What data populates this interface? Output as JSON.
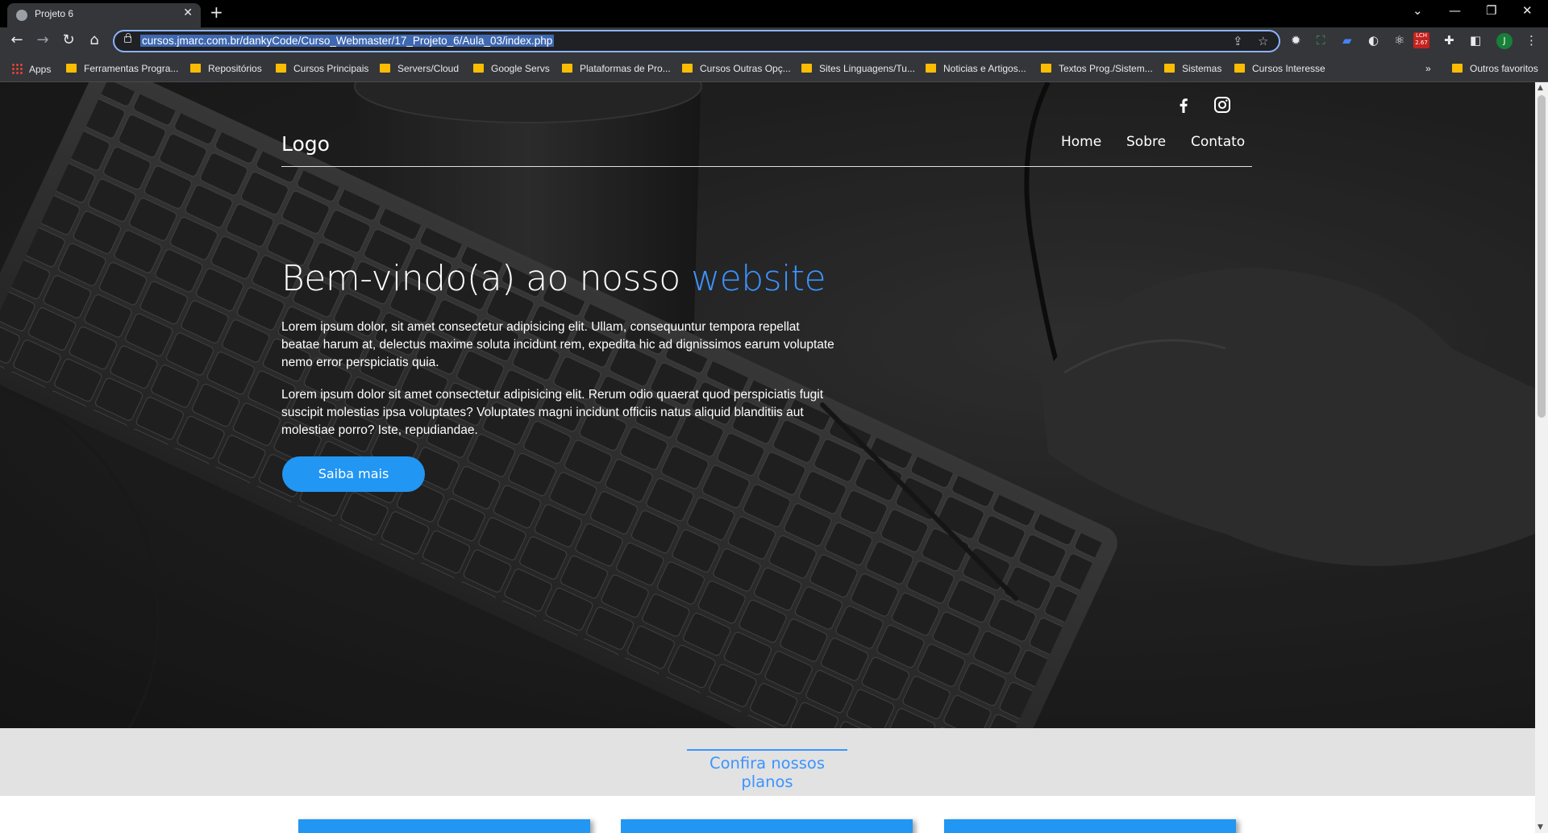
{
  "browser": {
    "tab_title": "Projeto 6",
    "url": "cursos.jmarc.com.br/dankyCode/Curso_Webmaster/17_Projeto_6/Aula_03/index.php",
    "extension_badge": "LCH 2.67",
    "profile_initial": "J",
    "bookmarks": [
      "Apps",
      "Ferramentas Progra...",
      "Repositórios",
      "Cursos Principais",
      "Servers/Cloud",
      "Google Servs",
      "Plataformas de Pro...",
      "Cursos Outras Opç...",
      "Sites Linguagens/Tu...",
      "Noticias e Artigos...",
      "Textos Prog./Sistem...",
      "Sistemas",
      "Cursos Interesse"
    ],
    "bookmarks_overflow": "»",
    "other_bookmarks": "Outros favoritos"
  },
  "site": {
    "logo": "Logo",
    "menu": [
      "Home",
      "Sobre",
      "Contato"
    ],
    "hero": {
      "title_prefix": "Bem-vindo(a) ao nosso ",
      "title_accent": "website",
      "paragraph1": "Lorem ipsum dolor, sit amet consectetur adipisicing elit. Ullam, consequuntur tempora repellat beatae harum at, delectus maxime soluta incidunt rem, expedita hic ad dignissimos earum voluptate nemo error perspiciatis quia.",
      "paragraph2": "Lorem ipsum dolor sit amet consectetur adipisicing elit. Rerum odio quaerat quod perspiciatis fugit suscipit molestias ipsa voluptates? Voluptates magni incidunt officiis natus aliquid blanditiis aut molestiae porro? Iste, repudiandae.",
      "cta_label": "Saiba mais"
    },
    "plans_title": "Confira nossos planos"
  },
  "colors": {
    "accent": "#3c94ff",
    "button": "#2196f3",
    "plans_band": "#e2e2e2"
  },
  "icons": [
    "facebook-icon",
    "instagram-icon"
  ]
}
